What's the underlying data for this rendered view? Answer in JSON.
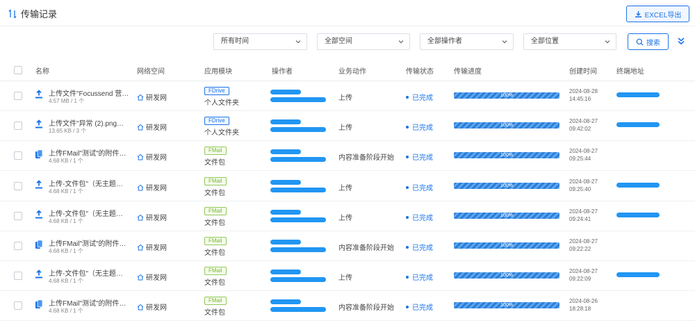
{
  "header": {
    "title": "传输记录",
    "export_label": "EXCEL导出"
  },
  "filters": {
    "time": "所有时间",
    "space": "全部空间",
    "operator": "全部操作者",
    "location": "全部位置",
    "search_label": "搜索"
  },
  "columns": {
    "name": "名称",
    "space": "网络空间",
    "module": "应用模块",
    "operator": "操作者",
    "action": "业务动作",
    "status": "传输状态",
    "progress": "传输进度",
    "created": "创建时间",
    "terminal": "终端地址"
  },
  "rows": [
    {
      "icon": "upload-icon",
      "name": "上传文件\"Focussend 营…",
      "size": "4.57 MB / 1 个",
      "space": "研发网",
      "module_tag": "FDrive",
      "module_sub": "个人文件夹",
      "action": "上传",
      "status": "已完成",
      "progress": 1.0,
      "progress_label": "100%",
      "date": "2024-08-28",
      "time": "14:45:16",
      "has_terminal": true
    },
    {
      "icon": "upload-icon",
      "name": "上传文件\"异常 (2).png等…",
      "size": "13.65 KB / 3 个",
      "space": "研发网",
      "module_tag": "FDrive",
      "module_sub": "个人文件夹",
      "action": "上传",
      "status": "已完成",
      "progress": 1.0,
      "progress_label": "100%",
      "date": "2024-08-27",
      "time": "09:42:02",
      "has_terminal": true
    },
    {
      "icon": "copy-icon",
      "name": "上传FMail\"测试\"的附件…",
      "size": "4.68 KB / 1 个",
      "space": "研发网",
      "module_tag": "FMail",
      "module_sub": "文件包",
      "action": "内容准备阶段开始",
      "status": "已完成",
      "progress": 1.0,
      "progress_label": "100%",
      "date": "2024-08-27",
      "time": "09:25:44",
      "has_terminal": false
    },
    {
      "icon": "upload-icon",
      "name": "上传-文件包\"（无主题）…",
      "size": "4.68 KB / 1 个",
      "space": "研发网",
      "module_tag": "FMail",
      "module_sub": "文件包",
      "action": "上传",
      "status": "已完成",
      "progress": 1.0,
      "progress_label": "100%",
      "date": "2024-08-27",
      "time": "09:25:40",
      "has_terminal": true
    },
    {
      "icon": "upload-icon",
      "name": "上传-文件包\"（无主题）…",
      "size": "4.68 KB / 1 个",
      "space": "研发网",
      "module_tag": "FMail",
      "module_sub": "文件包",
      "action": "上传",
      "status": "已完成",
      "progress": 1.0,
      "progress_label": "100%",
      "date": "2024-08-27",
      "time": "09:24:41",
      "has_terminal": true
    },
    {
      "icon": "copy-icon",
      "name": "上传FMail\"测试\"的附件…",
      "size": "4.68 KB / 1 个",
      "space": "研发网",
      "module_tag": "FMail",
      "module_sub": "文件包",
      "action": "内容准备阶段开始",
      "status": "已完成",
      "progress": 1.0,
      "progress_label": "100%",
      "date": "2024-08-27",
      "time": "09:22:22",
      "has_terminal": false
    },
    {
      "icon": "upload-icon",
      "name": "上传-文件包\"（无主题）…",
      "size": "4.68 KB / 1 个",
      "space": "研发网",
      "module_tag": "FMail",
      "module_sub": "文件包",
      "action": "上传",
      "status": "已完成",
      "progress": 1.0,
      "progress_label": "100%",
      "date": "2024-08-27",
      "time": "09:22:09",
      "has_terminal": true
    },
    {
      "icon": "copy-icon",
      "name": "上传FMail\"测试\"的附件…",
      "size": "4.68 KB / 1 个",
      "space": "研发网",
      "module_tag": "FMail",
      "module_sub": "文件包",
      "action": "内容准备阶段开始",
      "status": "已完成",
      "progress": 1.0,
      "progress_label": "100%",
      "date": "2024-08-26",
      "time": "18:28:18",
      "has_terminal": false
    }
  ],
  "colors": {
    "accent": "#1a73e8",
    "fmail": "#7cba34",
    "progress": "#2b7ed8"
  }
}
